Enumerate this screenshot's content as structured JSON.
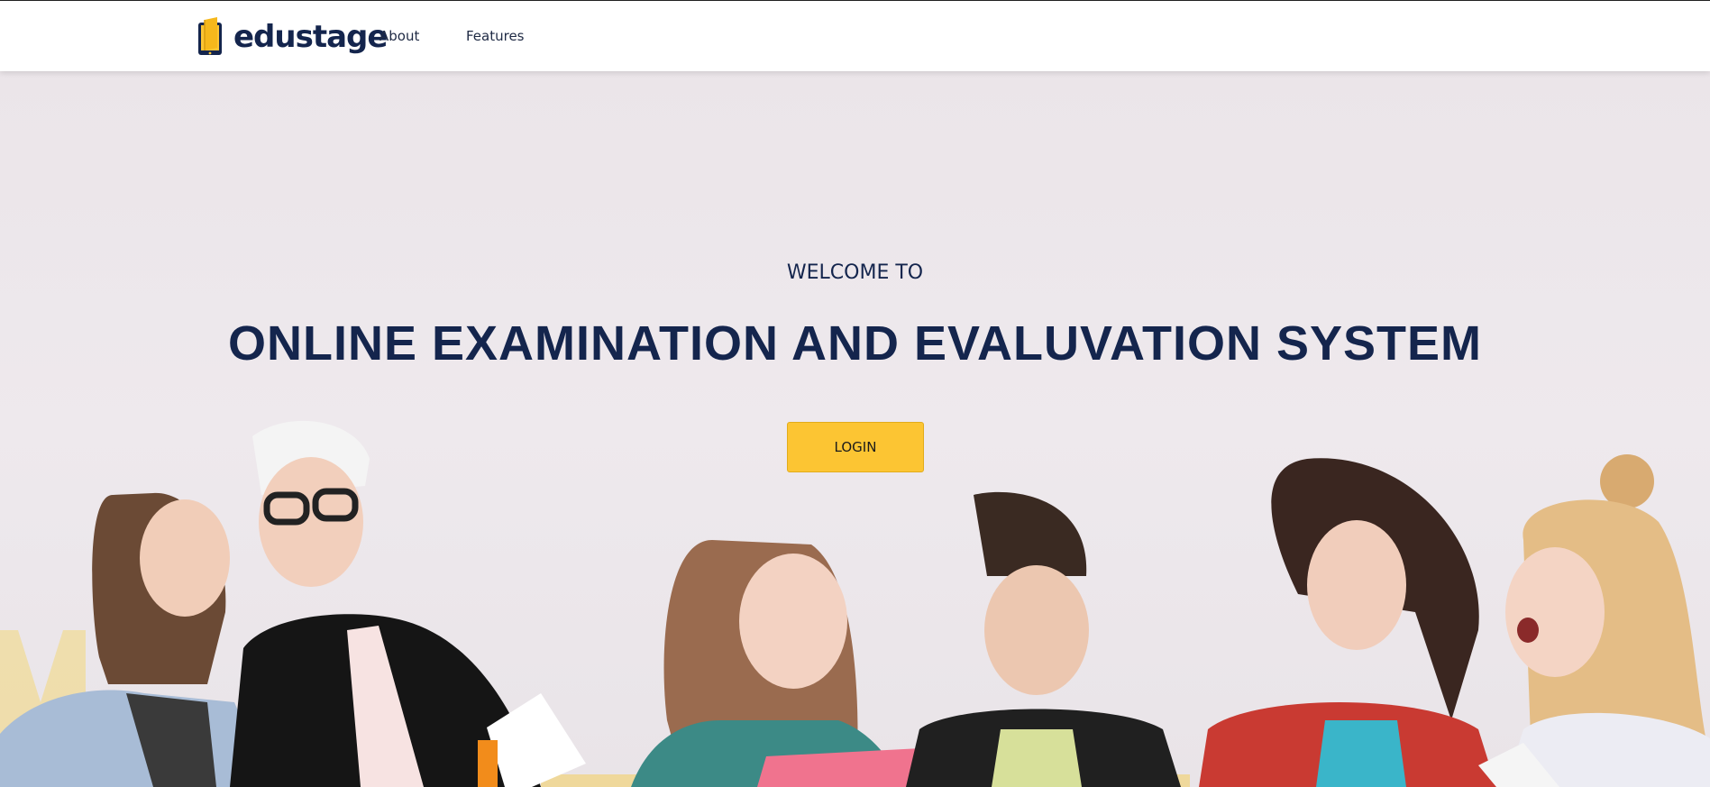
{
  "navbar": {
    "logo_text": "edustage",
    "links": [
      {
        "label": "About"
      },
      {
        "label": "Features"
      }
    ]
  },
  "hero": {
    "welcome": "WELCOME TO",
    "headline": "ONLINE EXAMINATION AND EVALUVATION SYSTEM",
    "login_label": "LOGIN"
  },
  "colors": {
    "brand_navy": "#14254d",
    "accent_yellow": "#fcc533",
    "hero_background": "#ece6ea"
  },
  "icons": {
    "logo": "book-tablet-icon"
  }
}
